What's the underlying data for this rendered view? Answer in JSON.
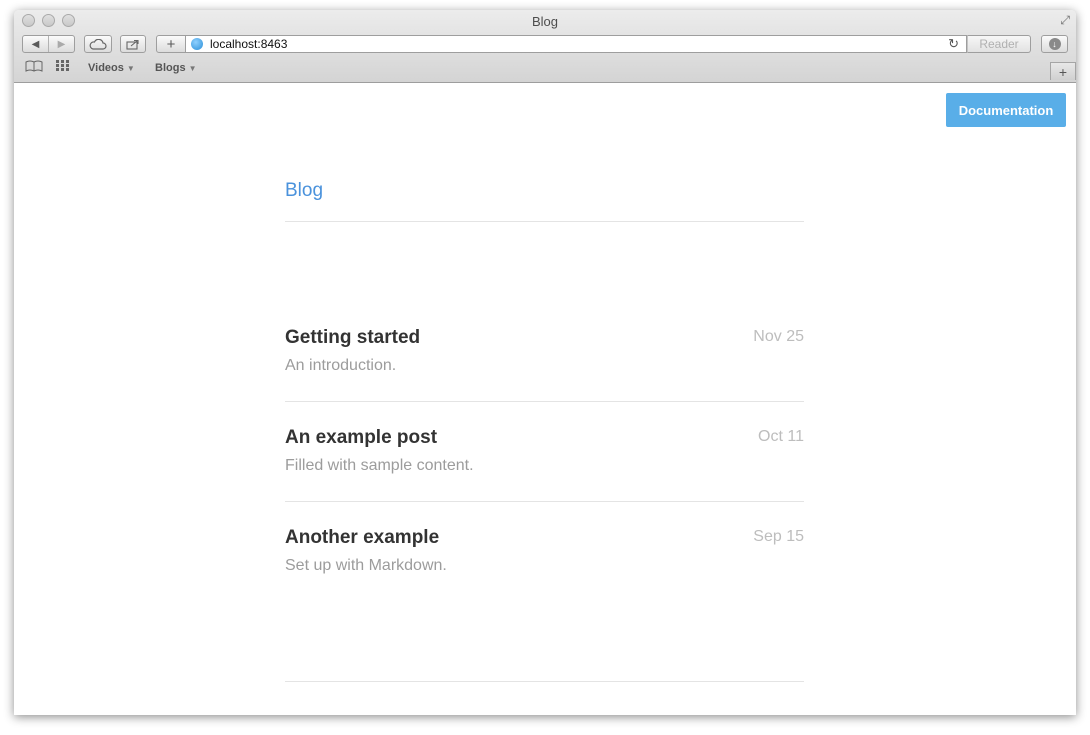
{
  "window": {
    "title": "Blog"
  },
  "toolbar": {
    "back_icon": "back-arrow-icon",
    "forward_icon": "forward-arrow-icon",
    "url": "localhost:8463",
    "reader_label": "Reader"
  },
  "bookmarks": {
    "items": [
      {
        "label": "Videos"
      },
      {
        "label": "Blogs"
      }
    ]
  },
  "page": {
    "doc_button": "Documentation",
    "blog_title": "Blog",
    "accent_color": "#4a92dc",
    "button_color": "#59aee8",
    "posts": [
      {
        "title": "Getting started",
        "date": "Nov 25",
        "description": "An introduction."
      },
      {
        "title": "An example post",
        "date": "Oct 11",
        "description": "Filled with sample content."
      },
      {
        "title": "Another example",
        "date": "Sep 15",
        "description": "Set up with Markdown."
      }
    ]
  }
}
